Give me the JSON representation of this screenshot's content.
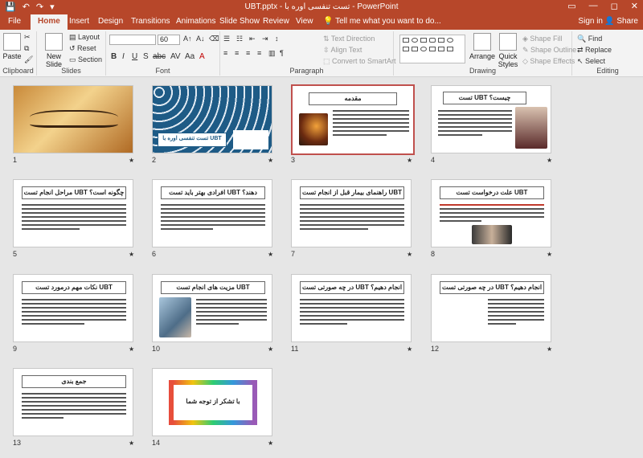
{
  "titlebar": {
    "title": "UBT.pptx - تست تنفسی اوره با - PowerPoint",
    "qat": [
      "💾",
      "↶",
      "↷",
      "▾"
    ],
    "controls": [
      "▭",
      "—",
      "◻",
      "✕"
    ]
  },
  "tabs": [
    {
      "label": "File"
    },
    {
      "label": "Home"
    },
    {
      "label": "Insert"
    },
    {
      "label": "Design"
    },
    {
      "label": "Transitions"
    },
    {
      "label": "Animations"
    },
    {
      "label": "Slide Show"
    },
    {
      "label": "Review"
    },
    {
      "label": "View"
    }
  ],
  "tell_me": "Tell me what you want to do...",
  "sign_in": "Sign in",
  "share": "Share",
  "ribbon": {
    "clipboard": {
      "label": "Clipboard",
      "paste": "Paste"
    },
    "slides": {
      "label": "Slides",
      "new_slide": "New Slide",
      "layout": "Layout",
      "reset": "Reset",
      "section": "Section"
    },
    "font": {
      "label": "Font",
      "size": "60"
    },
    "paragraph": {
      "label": "Paragraph",
      "text_direction": "Text Direction",
      "align_text": "Align Text",
      "convert_smartart": "Convert to SmartArt"
    },
    "drawing": {
      "label": "Drawing",
      "arrange": "Arrange",
      "quick_styles": "Quick Styles",
      "shape_fill": "Shape Fill",
      "shape_outline": "Shape Outline",
      "shape_effects": "Shape Effects"
    },
    "editing": {
      "label": "Editing",
      "find": "Find",
      "replace": "Replace",
      "select": "Select"
    }
  },
  "slides": [
    {
      "num": "1",
      "title": ""
    },
    {
      "num": "2",
      "title": "تست تنفسی اوره با UBT"
    },
    {
      "num": "3",
      "title": "مقدمه"
    },
    {
      "num": "4",
      "title": "تست UBT چیست؟"
    },
    {
      "num": "5",
      "title": "مراحل انجام تست UBT چگونه است؟"
    },
    {
      "num": "6",
      "title": "افرادی بهتر باید تست UBT دهند؟"
    },
    {
      "num": "7",
      "title": "راهنمای بیمار قبل از انجام تست UBT"
    },
    {
      "num": "8",
      "title": "علت درخواست تست UBT"
    },
    {
      "num": "9",
      "title": "نکات مهم درمورد تست UBT"
    },
    {
      "num": "10",
      "title": "مزیت های انجام تست UBT"
    },
    {
      "num": "11",
      "title": "در چه صورتی تست UBT انجام دهیم؟"
    },
    {
      "num": "12",
      "title": "در چه صورتی تست UBT انجام دهیم؟"
    },
    {
      "num": "13",
      "title": "جمع بندی"
    },
    {
      "num": "14",
      "title": "با تشکر از توجه شما"
    }
  ],
  "star": "★",
  "colors": {
    "accent": "#b7472a",
    "selected": "#c0504d"
  }
}
